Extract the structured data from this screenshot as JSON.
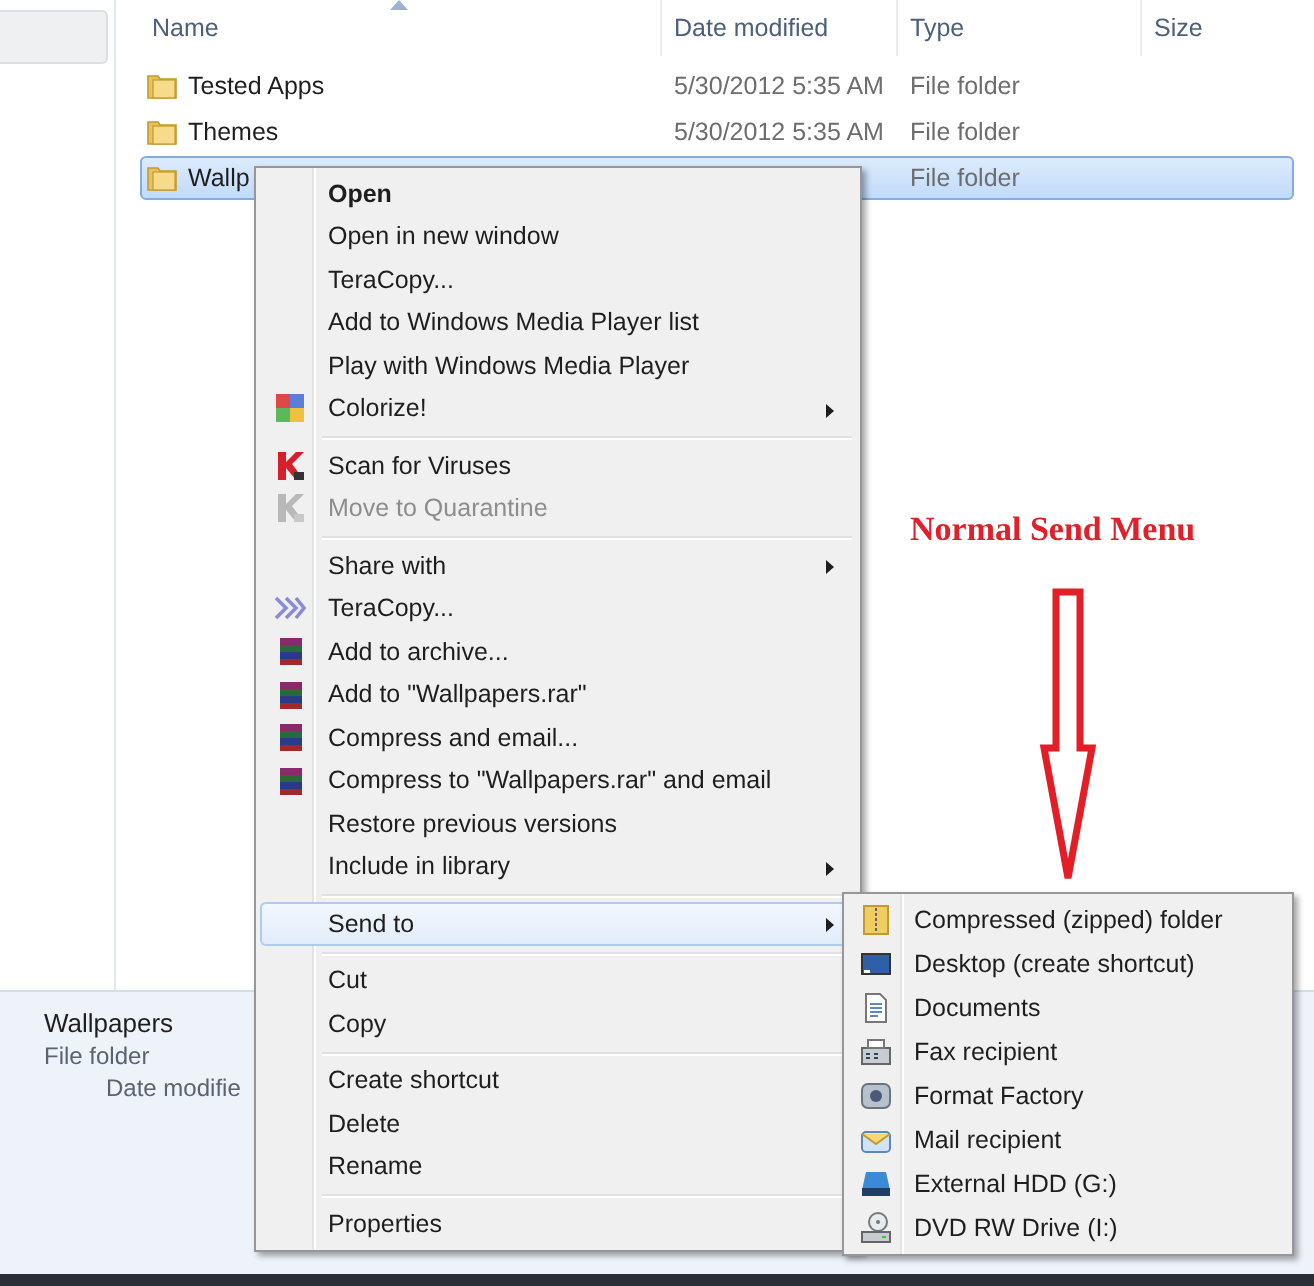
{
  "file_list": {
    "columns": [
      "Name",
      "Date modified",
      "Type",
      "Size"
    ],
    "rows": [
      {
        "name": "Tested Apps",
        "date": "5/30/2012 5:35 AM",
        "type": "File folder",
        "selected": false
      },
      {
        "name": "Themes",
        "date": "5/30/2012 5:35 AM",
        "type": "File folder",
        "selected": false
      },
      {
        "name": "Wallp",
        "type": "File folder",
        "selected": true
      }
    ]
  },
  "details_pane": {
    "name": "Wallpapers",
    "type": "File folder",
    "date_label": "Date modifie"
  },
  "context_menu": {
    "groups": [
      [
        {
          "label": "Open",
          "kind": "plain",
          "bold": true,
          "submenu": false,
          "disabled": false,
          "selected": false
        },
        {
          "label": "Open in new window",
          "kind": "plain",
          "bold": false,
          "submenu": false,
          "disabled": false,
          "selected": false
        },
        {
          "label": "TeraCopy...",
          "kind": "plain",
          "bold": false,
          "submenu": false,
          "disabled": false,
          "selected": false
        },
        {
          "label": "Add to Windows Media Player list",
          "kind": "plain",
          "bold": false,
          "submenu": false,
          "disabled": false,
          "selected": false
        },
        {
          "label": "Play with Windows Media Player",
          "kind": "plain",
          "bold": false,
          "submenu": false,
          "disabled": false,
          "selected": false
        },
        {
          "label": "Colorize!",
          "kind": "palette",
          "bold": false,
          "submenu": true,
          "disabled": false,
          "selected": false
        }
      ],
      [
        {
          "label": "Scan for Viruses",
          "kind": "scanner",
          "bold": false,
          "submenu": false,
          "disabled": false,
          "selected": false
        },
        {
          "label": "Move to Quarantine",
          "kind": "scanner",
          "bold": false,
          "submenu": false,
          "disabled": true,
          "selected": false
        }
      ],
      [
        {
          "label": "Share with",
          "kind": "plain",
          "bold": false,
          "submenu": true,
          "disabled": false,
          "selected": false
        },
        {
          "label": "TeraCopy...",
          "kind": "chevrons",
          "bold": false,
          "submenu": false,
          "disabled": false,
          "selected": false
        },
        {
          "label": "Add to archive...",
          "kind": "books",
          "bold": false,
          "submenu": false,
          "disabled": false,
          "selected": false
        },
        {
          "label": "Add to \"Wallpapers.rar\"",
          "kind": "books",
          "bold": false,
          "submenu": false,
          "disabled": false,
          "selected": false
        },
        {
          "label": "Compress and email...",
          "kind": "books",
          "bold": false,
          "submenu": false,
          "disabled": false,
          "selected": false
        },
        {
          "label": "Compress to \"Wallpapers.rar\" and email",
          "kind": "books",
          "bold": false,
          "submenu": false,
          "disabled": false,
          "selected": false
        },
        {
          "label": "Restore previous versions",
          "kind": "plain",
          "bold": false,
          "submenu": false,
          "disabled": false,
          "selected": false
        },
        {
          "label": "Include in library",
          "kind": "plain",
          "bold": false,
          "submenu": true,
          "disabled": false,
          "selected": false
        }
      ],
      [
        {
          "label": "Send to",
          "kind": "plain",
          "bold": false,
          "submenu": true,
          "disabled": false,
          "selected": true
        }
      ],
      [
        {
          "label": "Cut",
          "kind": "plain",
          "bold": false,
          "submenu": false,
          "disabled": false,
          "selected": false
        },
        {
          "label": "Copy",
          "kind": "plain",
          "bold": false,
          "submenu": false,
          "disabled": false,
          "selected": false
        }
      ],
      [
        {
          "label": "Create shortcut",
          "kind": "plain",
          "bold": false,
          "submenu": false,
          "disabled": false,
          "selected": false
        },
        {
          "label": "Delete",
          "kind": "plain",
          "bold": false,
          "submenu": false,
          "disabled": false,
          "selected": false
        },
        {
          "label": "Rename",
          "kind": "plain",
          "bold": false,
          "submenu": false,
          "disabled": false,
          "selected": false
        }
      ],
      [
        {
          "label": "Properties",
          "kind": "plain",
          "bold": false,
          "submenu": false,
          "disabled": false,
          "selected": false
        }
      ]
    ]
  },
  "send_to_menu": {
    "items": [
      {
        "label": "Compressed (zipped) folder",
        "kind": "zip"
      },
      {
        "label": "Desktop (create shortcut)",
        "kind": "desktop"
      },
      {
        "label": "Documents",
        "kind": "document"
      },
      {
        "label": "Fax recipient",
        "kind": "fax"
      },
      {
        "label": "Format Factory",
        "kind": "factory"
      },
      {
        "label": "Mail recipient",
        "kind": "mail"
      },
      {
        "label": "External HDD (G:)",
        "kind": "drive"
      },
      {
        "label": "DVD RW Drive (I:)",
        "kind": "dvd"
      }
    ]
  },
  "annotation": {
    "text": "Normal Send Menu"
  }
}
